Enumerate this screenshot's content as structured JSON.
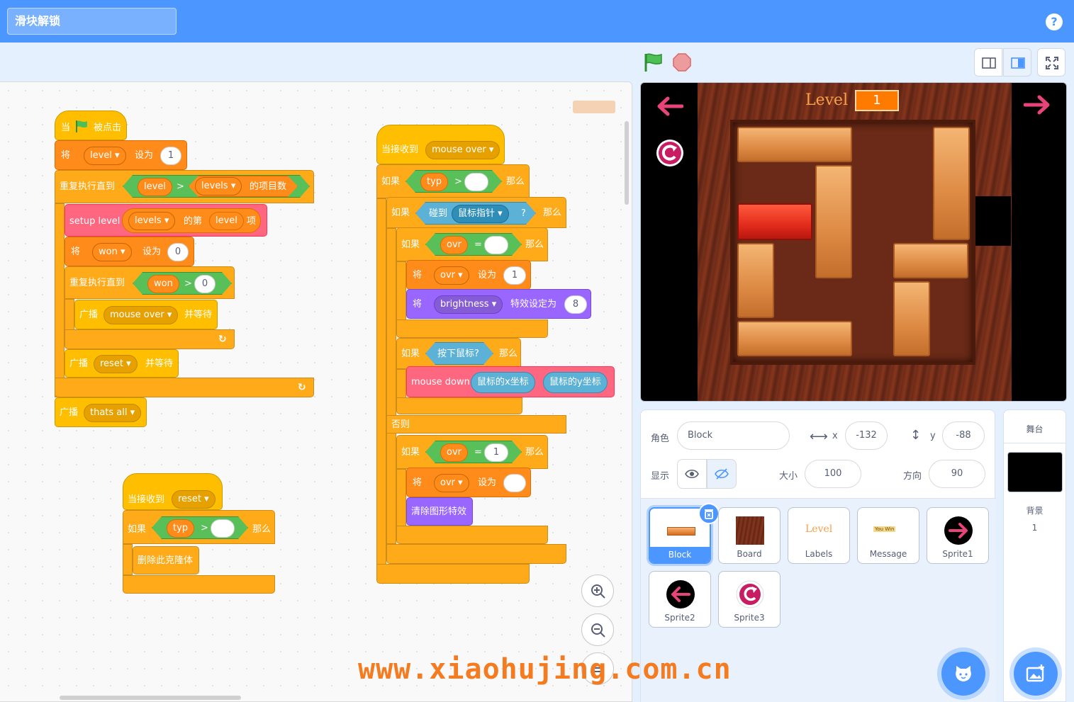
{
  "project_title": "滑块解锁",
  "help_label": "?",
  "workspace": {
    "script1": {
      "when_label": "当",
      "flag_clicked": "被点击",
      "set": "将",
      "level_var": "level",
      "to": "设为",
      "one": "1",
      "repeat_until": "重复执行直到",
      "level": "level",
      "gt": ">",
      "levels": "levels",
      "item_count": "的项目数",
      "setup_level": "setup level",
      "levels2": "levels",
      "of_item": "的第",
      "level2": "level",
      "item": "项",
      "set2": "将",
      "won": "won",
      "to2": "设为",
      "zero": "0",
      "repeat_until2": "重复执行直到",
      "won2": "won",
      "gt2": ">",
      "zero2": "0",
      "broadcast": "广播",
      "mouse_over": "mouse over",
      "and_wait": "并等待",
      "broadcast2": "广播",
      "reset": "reset",
      "and_wait2": "并等待",
      "broadcast3": "广播",
      "thats_all": "thats all"
    },
    "script2": {
      "when_receive": "当接收到",
      "reset": "reset",
      "if": "如果",
      "typ": "typ",
      "gt": ">",
      "then": "那么",
      "delete_clone": "删除此克隆体"
    },
    "script3": {
      "when_receive": "当接收到",
      "mouse_over": "mouse over",
      "if": "如果",
      "typ": "typ",
      "gt": ">",
      "then": "那么",
      "if2": "如果",
      "touching": "碰到",
      "mouse_pointer": "鼠标指针",
      "q": "?",
      "then2": "那么",
      "if3": "如果",
      "ovr": "ovr",
      "eq": "=",
      "then3": "那么",
      "set": "将",
      "ovr2": "ovr",
      "to": "设为",
      "one": "1",
      "set_effect": "将",
      "brightness": "brightness",
      "effect_to": "特效设定为",
      "eight": "8",
      "if4": "如果",
      "mouse_down_q": "按下鼠标?",
      "then4": "那么",
      "mouse_down": "mouse down",
      "mouse_x": "鼠标的x坐标",
      "mouse_y": "鼠标的y坐标",
      "else": "否则",
      "if5": "如果",
      "ovr3": "ovr",
      "eq2": "=",
      "one2": "1",
      "then5": "那么",
      "set2": "将",
      "ovr4": "ovr",
      "to2": "设为",
      "clear_effects": "清除图形特效"
    }
  },
  "stage": {
    "level_label": "Level",
    "level_value": "1"
  },
  "sprite_info": {
    "sprite_label": "角色",
    "sprite_name": "Block",
    "x_label": "x",
    "x_value": "-132",
    "y_label": "y",
    "y_value": "-88",
    "show_label": "显示",
    "size_label": "大小",
    "size_value": "100",
    "direction_label": "方向",
    "direction_value": "90"
  },
  "sprites": [
    {
      "name": "Block"
    },
    {
      "name": "Board"
    },
    {
      "name": "Labels"
    },
    {
      "name": "Message"
    },
    {
      "name": "Sprite1"
    },
    {
      "name": "Sprite2"
    },
    {
      "name": "Sprite3"
    }
  ],
  "labels_thumb_text": "Level",
  "message_thumb_text": "You Win",
  "stage_panel": {
    "title": "舞台",
    "backdrops_label": "背景",
    "backdrops_count": "1"
  },
  "watermark": "www.xiaohujing.com.cn",
  "colors": {
    "accent": "#4c97ff",
    "events": "#ffbf00",
    "control": "#ffab19",
    "variables": "#ff8c1a",
    "operators": "#59c059",
    "pen": "#ff6680",
    "looks": "#9966ff",
    "sensing": "#5cb1d6"
  }
}
